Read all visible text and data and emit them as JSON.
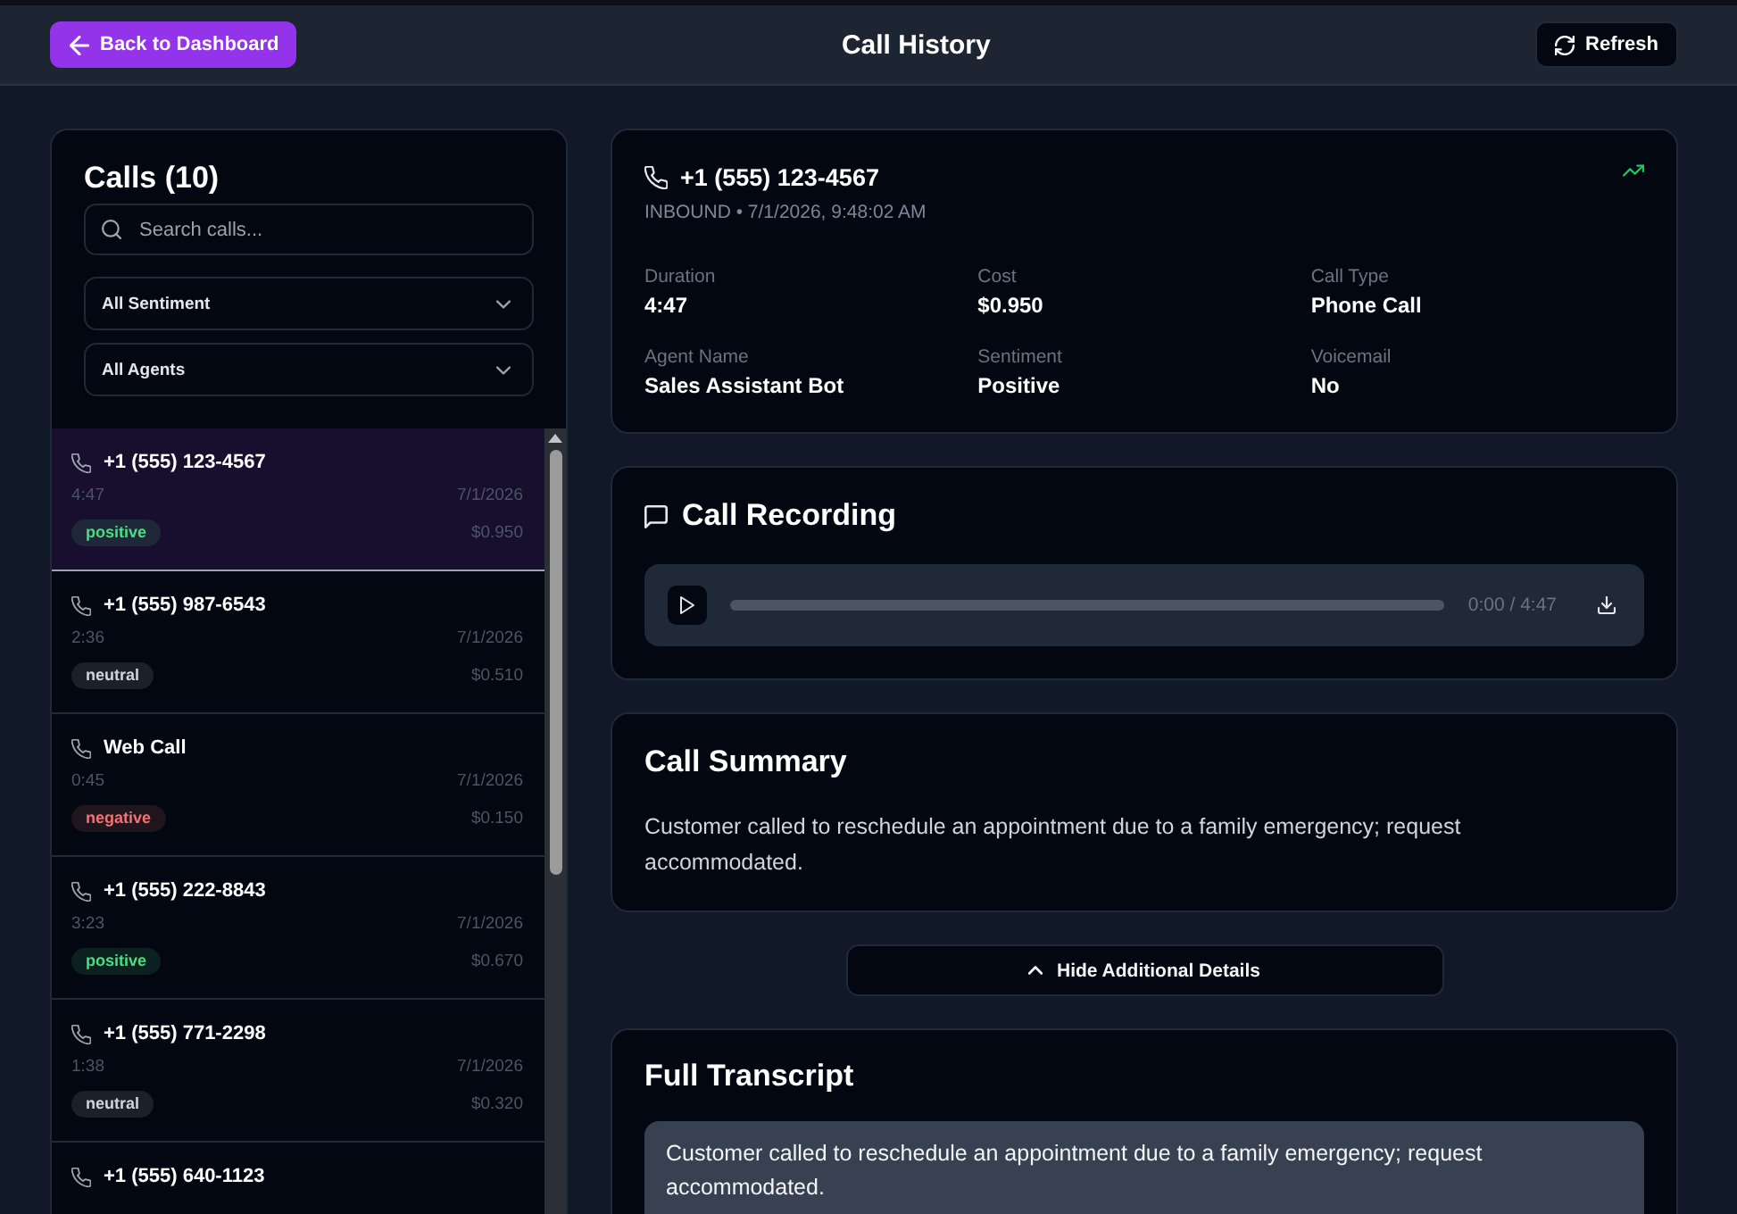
{
  "header": {
    "back_button": "Back to Dashboard",
    "title": "Call History",
    "refresh_button": "Refresh"
  },
  "calls_panel": {
    "title": "Calls (10)",
    "search": {
      "placeholder": "Search calls..."
    },
    "filters": [
      {
        "value": "All Sentiment"
      },
      {
        "value": "All Agents"
      }
    ],
    "items": [
      {
        "name": "+1 (555) 123-4567",
        "duration": "4:47",
        "date": "7/1/2026",
        "sentiment": "positive",
        "color": "#4ade80",
        "cost": "$0.950",
        "selected": true
      },
      {
        "name": "+1 (555) 987-6543",
        "duration": "2:36",
        "date": "7/1/2026",
        "sentiment": "neutral",
        "color": "#d1d5db",
        "cost": "$0.510",
        "selected": false
      },
      {
        "name": "Web Call",
        "duration": "0:45",
        "date": "7/1/2026",
        "sentiment": "negative",
        "color": "#f87171",
        "cost": "$0.150",
        "selected": false
      },
      {
        "name": "+1 (555) 222-8843",
        "duration": "3:23",
        "date": "7/1/2026",
        "sentiment": "positive",
        "color": "#4ade80",
        "cost": "$0.670",
        "selected": false
      },
      {
        "name": "+1 (555) 771-2298",
        "duration": "1:38",
        "date": "7/1/2026",
        "sentiment": "neutral",
        "color": "#d1d5db",
        "cost": "$0.320",
        "selected": false
      },
      {
        "name": "+1 (555) 640-1123",
        "selected": false
      }
    ]
  },
  "detail": {
    "phone": "+1 (555) 123-4567",
    "subtitle": "INBOUND • 7/1/2026, 9:48:02 AM",
    "fields": [
      {
        "label": "Duration",
        "value": "4:47"
      },
      {
        "label": "Cost",
        "value": "$0.950"
      },
      {
        "label": "Call Type",
        "value": "Phone Call"
      },
      {
        "label": "Agent Name",
        "value": "Sales Assistant Bot"
      },
      {
        "label": "Sentiment",
        "value": "Positive"
      },
      {
        "label": "Voicemail",
        "value": "No"
      }
    ]
  },
  "recording": {
    "title": "Call Recording",
    "player": {
      "time": "0:00 / 4:47"
    }
  },
  "summary": {
    "title": "Call Summary",
    "text": "Customer called to reschedule an appointment due to a family emergency; request accommodated."
  },
  "toggle_button": {
    "label": "Hide Additional Details",
    "expanded": true
  },
  "transcript": {
    "title": "Full Transcript",
    "text": "Customer called to reschedule an appointment due to a family emergency; request accommodated."
  }
}
